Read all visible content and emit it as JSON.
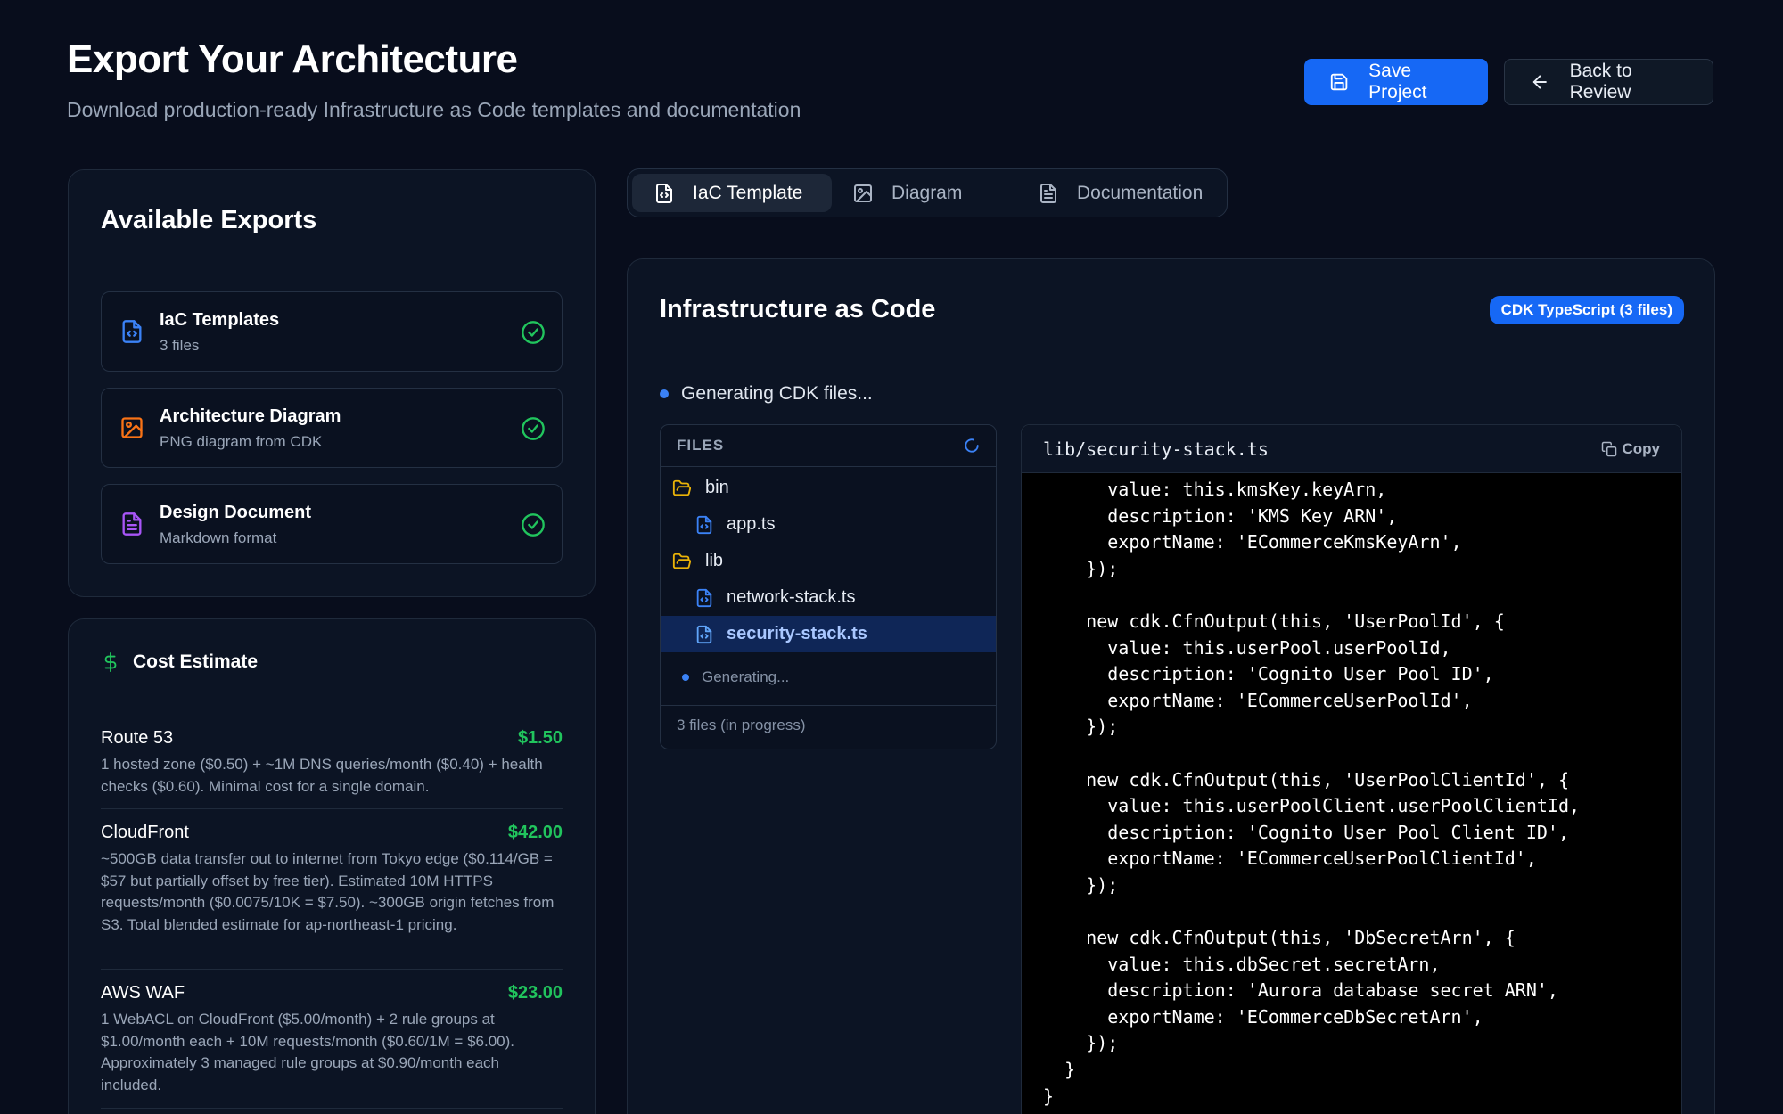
{
  "header": {
    "title": "Export Your Architecture",
    "subtitle": "Download production-ready Infrastructure as Code templates and documentation",
    "save_label": "Save Project",
    "back_label": "Back to Review"
  },
  "exports": {
    "title": "Available Exports",
    "items": [
      {
        "name": "IaC Templates",
        "desc": "3 files",
        "icon": "file-code-icon",
        "color": "#3b82f6"
      },
      {
        "name": "Architecture Diagram",
        "desc": "PNG diagram from CDK",
        "icon": "image-icon",
        "color": "#f97316"
      },
      {
        "name": "Design Document",
        "desc": "Markdown format",
        "icon": "file-text-icon",
        "color": "#a855f7"
      }
    ]
  },
  "cost": {
    "title": "Cost Estimate",
    "items": [
      {
        "service": "Route 53",
        "amount": "$1.50",
        "note": "1 hosted zone ($0.50) + ~1M DNS queries/month ($0.40) + health checks ($0.60). Minimal cost for a single domain."
      },
      {
        "service": "CloudFront",
        "amount": "$42.00",
        "note": "~500GB data transfer out to internet from Tokyo edge ($0.114/GB = $57 but partially offset by free tier). Estimated 10M HTTPS requests/month ($0.0075/10K = $7.50). ~300GB origin fetches from S3. Total blended estimate for ap-northeast-1 pricing."
      },
      {
        "service": "AWS WAF",
        "amount": "$23.00",
        "note": "1 WebACL on CloudFront ($5.00/month) + 2 rule groups at $1.00/month each + 10M requests/month ($0.60/1M = $6.00). Approximately 3 managed rule groups at $0.90/month each included."
      }
    ]
  },
  "tabs": [
    {
      "label": "IaC Template",
      "icon": "file-code-icon",
      "active": true
    },
    {
      "label": "Diagram",
      "icon": "image-icon",
      "active": false
    },
    {
      "label": "Documentation",
      "icon": "file-text-icon",
      "active": false
    }
  ],
  "iac": {
    "title": "Infrastructure as Code",
    "badge": "CDK TypeScript (3 files)",
    "status": "Generating CDK files...",
    "files_label": "FILES",
    "tree": [
      {
        "name": "bin",
        "type": "folder"
      },
      {
        "name": "app.ts",
        "type": "file"
      },
      {
        "name": "lib",
        "type": "folder"
      },
      {
        "name": "network-stack.ts",
        "type": "file"
      },
      {
        "name": "security-stack.ts",
        "type": "file",
        "selected": true
      }
    ],
    "generating": "Generating...",
    "files_footer": "3 files (in progress)",
    "code_path": "lib/security-stack.ts",
    "copy_label": "Copy",
    "code": "      value: this.kmsKey.keyArn,\n      description: 'KMS Key ARN',\n      exportName: 'ECommerceKmsKeyArn',\n    });\n\n    new cdk.CfnOutput(this, 'UserPoolId', {\n      value: this.userPool.userPoolId,\n      description: 'Cognito User Pool ID',\n      exportName: 'ECommerceUserPoolId',\n    });\n\n    new cdk.CfnOutput(this, 'UserPoolClientId', {\n      value: this.userPoolClient.userPoolClientId,\n      description: 'Cognito User Pool Client ID',\n      exportName: 'ECommerceUserPoolClientId',\n    });\n\n    new cdk.CfnOutput(this, 'DbSecretArn', {\n      value: this.dbSecret.secretArn,\n      description: 'Aurora database secret ARN',\n      exportName: 'ECommerceDbSecretArn',\n    });\n  }\n}"
  },
  "colors": {
    "background": "#080d1c",
    "primary": "#1668f5",
    "success": "#21c55d",
    "folder": "#eab308"
  }
}
